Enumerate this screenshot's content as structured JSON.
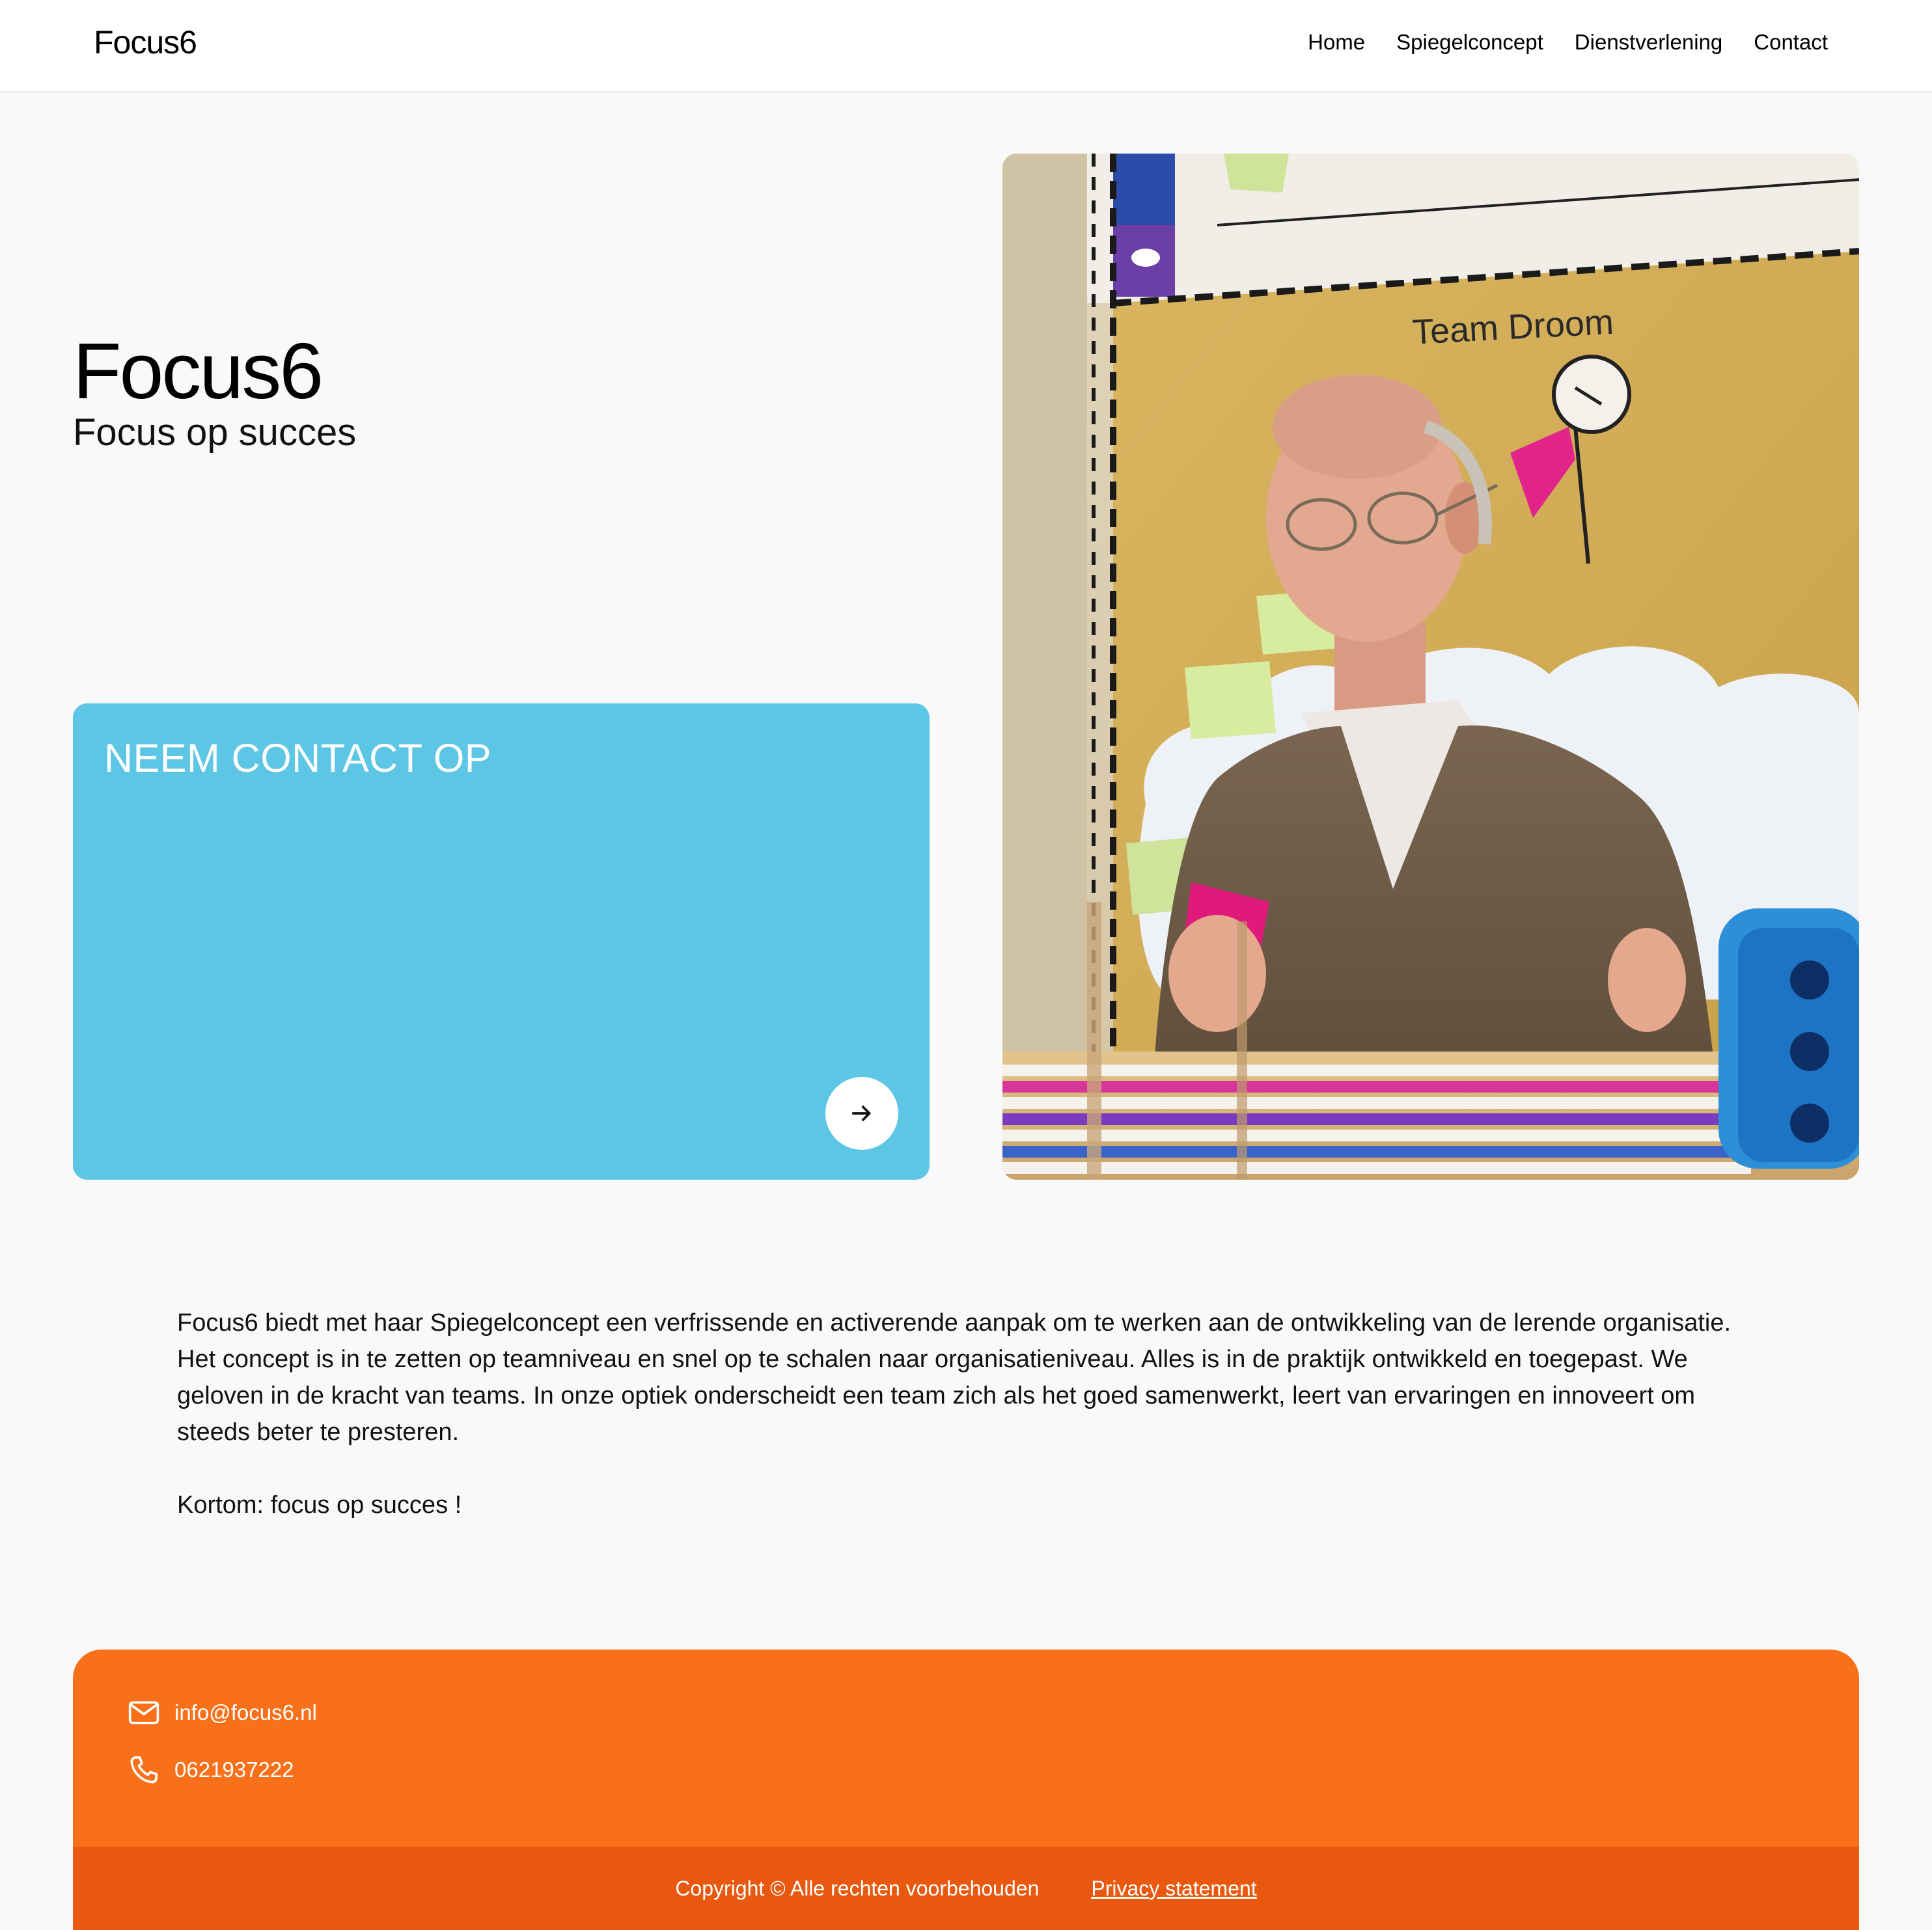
{
  "header": {
    "logo": "Focus6",
    "nav": [
      "Home",
      "Spiegelconcept",
      "Dienstverlening",
      "Contact"
    ]
  },
  "hero": {
    "title": "Focus6",
    "subtitle": "Focus op succes",
    "card_title": "NEEM CONTACT OP",
    "card_icon": "arrow-right-icon",
    "photo_sign_text": "Team Droom"
  },
  "intro": {
    "paragraph": "Focus6 biedt met haar Spiegelconcept een verfrissende en activerende aanpak om te werken aan de ontwikkeling van de lerende organisatie. Het concept is in te zetten op teamniveau en snel op te schalen naar organisatieniveau. Alles is in de praktijk ontwikkeld en toegepast. We geloven in de kracht van teams. In onze optiek onderscheidt een team zich als het goed samenwerkt, leert van ervaringen en innoveert om steeds beter te presteren.",
    "closing": "Kortom: focus op succes !"
  },
  "footer": {
    "email": "info@focus6.nl",
    "phone": "0621937222",
    "copyright": "Copyright © Alle rechten voorbehouden",
    "privacy": "Privacy statement"
  },
  "colors": {
    "card_blue": "#5cc6e4",
    "footer_orange": "#f8711a",
    "footer_bar": "#e9580f",
    "background": "#f9f9f9"
  }
}
